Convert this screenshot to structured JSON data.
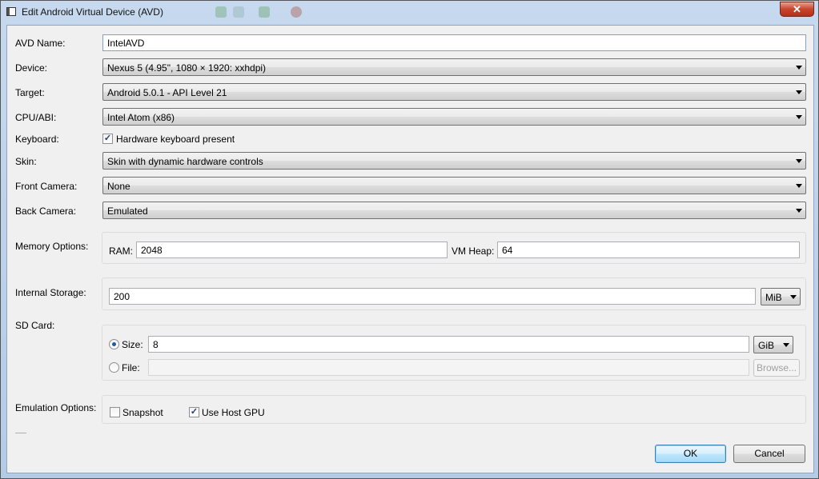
{
  "window": {
    "title": "Edit Android Virtual Device (AVD)",
    "close_glyph": "✕"
  },
  "form": {
    "avd_name": {
      "label": "AVD Name:",
      "value": "IntelAVD"
    },
    "device": {
      "label": "Device:",
      "value": "Nexus 5 (4.95\", 1080 × 1920: xxhdpi)"
    },
    "target": {
      "label": "Target:",
      "value": "Android 5.0.1 - API Level 21"
    },
    "cpu": {
      "label": "CPU/ABI:",
      "value": "Intel Atom (x86)"
    },
    "keyboard": {
      "label": "Keyboard:",
      "checkbox_label": "Hardware keyboard present",
      "checked": true
    },
    "skin": {
      "label": "Skin:",
      "value": "Skin with dynamic hardware controls"
    },
    "front_camera": {
      "label": "Front Camera:",
      "value": "None"
    },
    "back_camera": {
      "label": "Back Camera:",
      "value": "Emulated"
    },
    "memory": {
      "label": "Memory Options:",
      "ram_label": "RAM:",
      "ram_value": "2048",
      "heap_label": "VM Heap:",
      "heap_value": "64"
    },
    "internal_storage": {
      "label": "Internal Storage:",
      "value": "200",
      "unit": "MiB"
    },
    "sd_card": {
      "label": "SD Card:",
      "size_label": "Size:",
      "size_value": "8",
      "size_unit": "GiB",
      "size_selected": true,
      "file_label": "File:",
      "file_value": "",
      "browse_label": "Browse..."
    },
    "emulation": {
      "label": "Emulation Options:",
      "snapshot_label": "Snapshot",
      "snapshot_checked": false,
      "gpu_label": "Use Host GPU",
      "gpu_checked": true
    }
  },
  "buttons": {
    "ok": "OK",
    "cancel": "Cancel"
  },
  "glyphs": {
    "check": "✓"
  }
}
